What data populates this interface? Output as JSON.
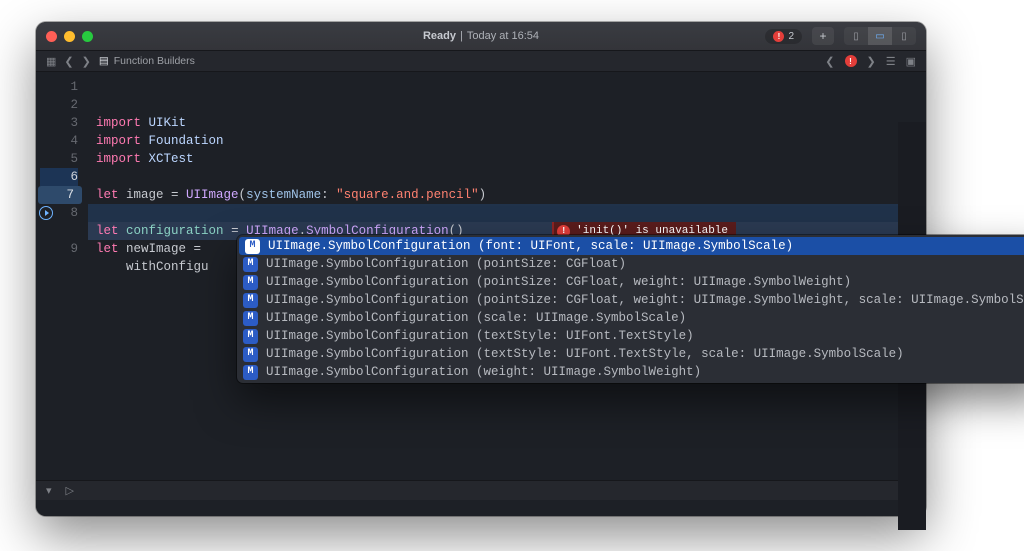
{
  "titlebar": {
    "status_strong": "Ready",
    "status_sep": " | ",
    "status_rest": "Today at 16:54",
    "error_count": "2",
    "plus_label": "+"
  },
  "navbar": {
    "breadcrumb_file": "Function Builders",
    "error_count": "1"
  },
  "editor": {
    "lines": [
      {
        "n": "1",
        "html": "<span class='kw'>import</span> <span class='typeLt'>UIKit</span>"
      },
      {
        "n": "2",
        "html": "<span class='kw'>import</span> <span class='typeLt'>Foundation</span>"
      },
      {
        "n": "3",
        "html": "<span class='kw'>import</span> <span class='typeLt'>XCTest</span>"
      },
      {
        "n": "4",
        "html": ""
      },
      {
        "n": "5",
        "html": "<span class='kw'>let</span> image = <span class='type'>UIImage</span><span class='punc'>(</span><span class='fn'>systemName</span>: <span class='str'>\"square.and.pencil\"</span><span class='punc'>)</span>"
      },
      {
        "n": "6",
        "html": "",
        "bp": true
      },
      {
        "n": "7",
        "html": "<span class='kw'>let</span> <span class='iden'>configuration</span> = <span class='type'>UIImage</span>.<span class='type'>SymbolConfiguration</span><span class='punc'>()</span>",
        "hl": true
      },
      {
        "n": "8",
        "html": "<span class='kw'>let</span> newImage = ",
        "run": true
      },
      {
        "n": "",
        "html": "    withConfigu"
      },
      {
        "n": "9",
        "html": ""
      }
    ],
    "error_text": "'init()' is unavailable"
  },
  "autocomplete": {
    "kind_label": "M",
    "items": [
      "UIImage.SymbolConfiguration (font: UIFont, scale: UIImage.SymbolScale)",
      "UIImage.SymbolConfiguration (pointSize: CGFloat)",
      "UIImage.SymbolConfiguration (pointSize: CGFloat, weight: UIImage.SymbolWeight)",
      "UIImage.SymbolConfiguration (pointSize: CGFloat, weight: UIImage.SymbolWeight, scale: UIImage.SymbolScale)",
      "UIImage.SymbolConfiguration (scale: UIImage.SymbolScale)",
      "UIImage.SymbolConfiguration (textStyle: UIFont.TextStyle)",
      "UIImage.SymbolConfiguration (textStyle: UIFont.TextStyle, scale: UIImage.SymbolScale)",
      "UIImage.SymbolConfiguration (weight: UIImage.SymbolWeight)"
    ]
  }
}
